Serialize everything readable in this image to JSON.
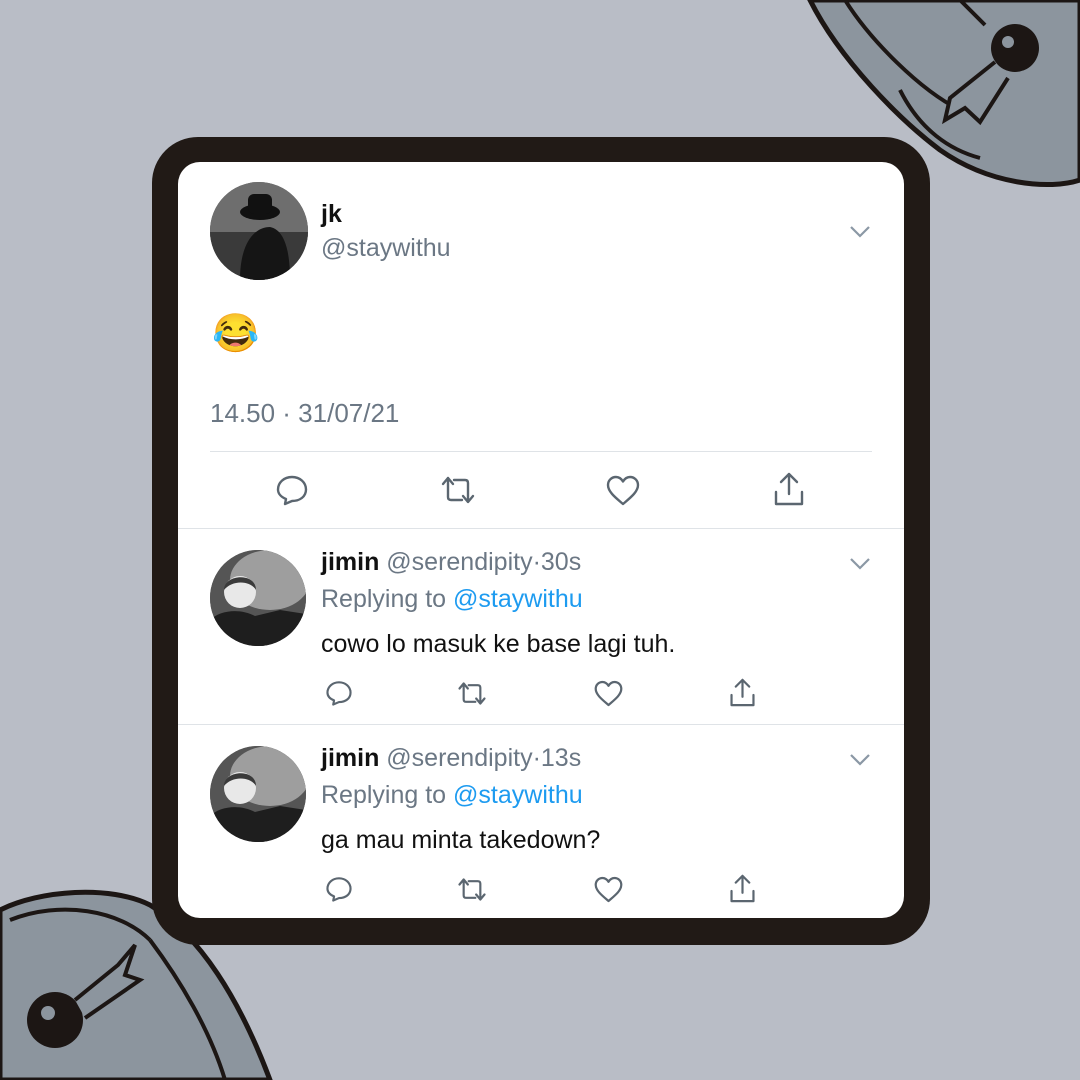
{
  "colors": {
    "background": "#b9bdc6",
    "frame": "#211a16",
    "card": "#ffffff",
    "mention": "#1d9bf0",
    "muted": "#6b7784"
  },
  "main_tweet": {
    "name": "jk",
    "handle": "@staywithu",
    "emoji": "😂",
    "timestamp": "14.50 · 31/07/21",
    "actions": [
      "reply-icon",
      "retweet-icon",
      "like-icon",
      "share-icon"
    ]
  },
  "replies": [
    {
      "name": "jimin",
      "handle": "@serendipity",
      "separator": "·",
      "time": "30s",
      "replying_label": "Replying to",
      "replying_to": "@staywithu",
      "text": "cowo lo masuk ke base lagi tuh."
    },
    {
      "name": "jimin",
      "handle": "@serendipity",
      "separator": "·",
      "time": "13s",
      "replying_label": "Replying to",
      "replying_to": "@staywithu",
      "text": "ga mau minta takedown?"
    }
  ],
  "decorations": [
    "padlock-icon",
    "padlock-icon"
  ]
}
